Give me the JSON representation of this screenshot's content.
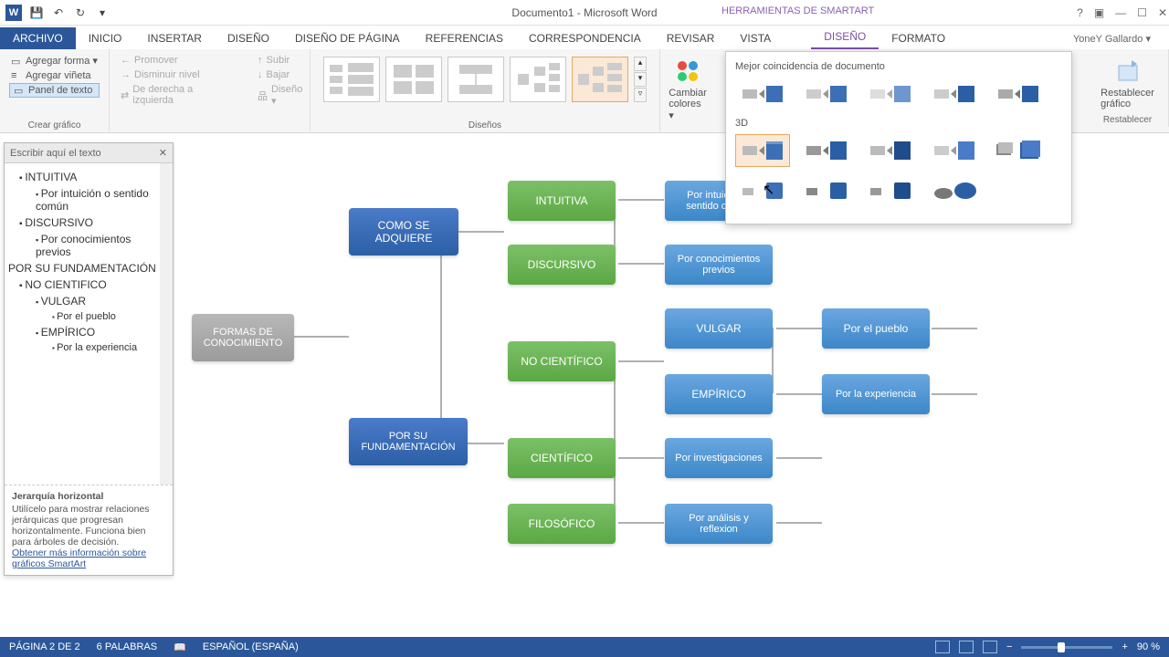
{
  "title": "Documento1 - Microsoft Word",
  "tool_context": "HERRAMIENTAS DE SMARTART",
  "user": "YoneY Gallardo ▾",
  "tabs": {
    "file": "ARCHIVO",
    "home": "INICIO",
    "insert": "INSERTAR",
    "design": "DISEÑO",
    "page_layout": "DISEÑO DE PÁGINA",
    "references": "REFERENCIAS",
    "mailings": "CORRESPONDENCIA",
    "review": "REVISAR",
    "view": "VISTA",
    "sa_design": "DISEÑO",
    "sa_format": "FORMATO"
  },
  "ribbon": {
    "add_shape": "Agregar forma ▾",
    "add_bullet": "Agregar viñeta",
    "text_pane": "Panel de texto",
    "promote": "Promover",
    "demote": "Disminuir nivel",
    "rtl": "De derecha a izquierda",
    "up": "Subir",
    "down": "Bajar",
    "layout_btn": "Diseño ▾",
    "group_create": "Crear gráfico",
    "group_layouts": "Diseños",
    "change_colors": "Cambiar colores ▾",
    "reset": "Restablecer gráfico",
    "group_reset": "Restablecer"
  },
  "styles_panel": {
    "best_match": "Mejor coincidencia de documento",
    "three_d": "3D"
  },
  "textpane": {
    "placeholder": "Escribir aquí el texto",
    "items": [
      {
        "lvl": "b1",
        "t": "INTUITIVA"
      },
      {
        "lvl": "b2",
        "t": "Por intuición o sentido común"
      },
      {
        "lvl": "b1",
        "t": "DISCURSIVO"
      },
      {
        "lvl": "b2",
        "t": "Por conocimientos previos"
      },
      {
        "lvl": "b0",
        "t": "POR SU FUNDAMENTACIÓN"
      },
      {
        "lvl": "b1",
        "t": "NO CIENTIFICO"
      },
      {
        "lvl": "b2",
        "t": "VULGAR"
      },
      {
        "lvl": "b3",
        "t": "Por el pueblo"
      },
      {
        "lvl": "b2",
        "t": "EMPÍRICO"
      },
      {
        "lvl": "b3",
        "t": "Por la experiencia"
      }
    ],
    "desc_title": "Jerarquía horizontal",
    "desc_body": "Utilícelo para mostrar relaciones jerárquicas que progresan horizontalmente. Funciona bien para árboles de decisión.",
    "desc_link": "Obtener más información sobre gráficos SmartArt"
  },
  "diagram": {
    "root": "FORMAS DE CONOCIMIENTO",
    "l1a": "COMO SE ADQUIERE",
    "l1b": "POR SU FUNDAMENTACIÓN",
    "l2a": "INTUITIVA",
    "l2b": "DISCURSIVO",
    "l2c": "NO CIENTÍFICO",
    "l2d": "CIENTÍFICO",
    "l2e": "FILOSÓFICO",
    "l3a": "Por intuición o sentido común",
    "l3b": "Por conocimientos previos",
    "l3c": "VULGAR",
    "l3d": "EMPÍRICO",
    "l3e": "Por investigaciones",
    "l3f": "Por análisis y reflexion",
    "l4a": "Por el pueblo",
    "l4b": "Por la experiencia"
  },
  "status": {
    "page": "PÁGINA 2 DE 2",
    "words": "6 PALABRAS",
    "lang": "ESPAÑOL (ESPAÑA)",
    "zoom": "90 %"
  }
}
